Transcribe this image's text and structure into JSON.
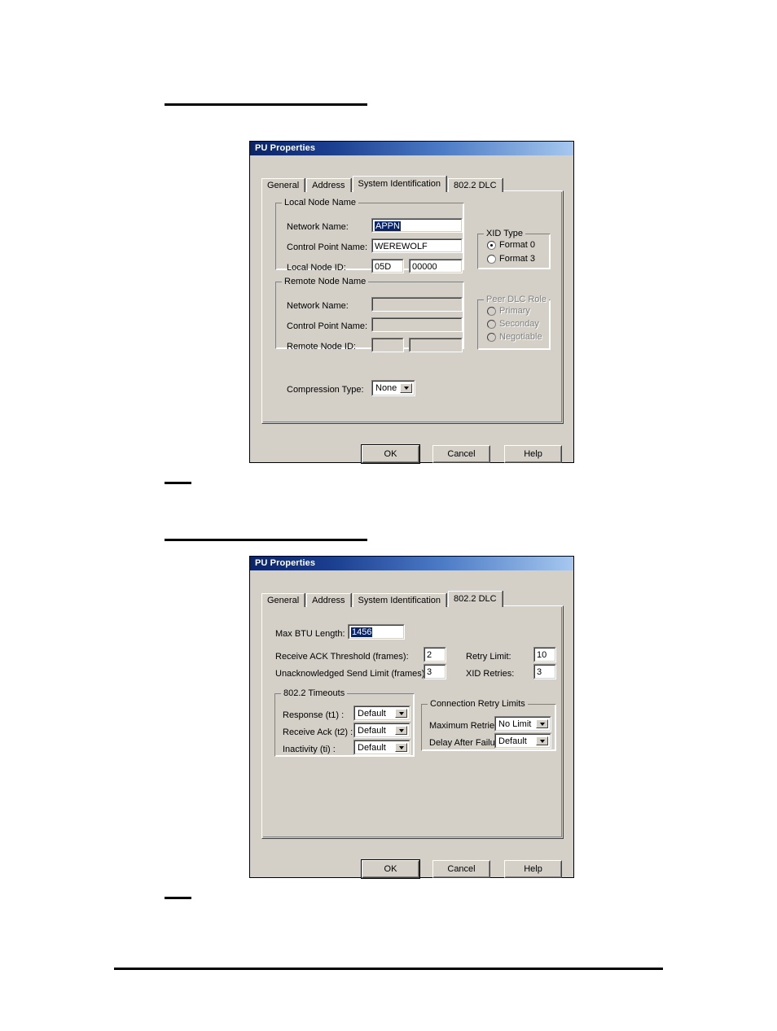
{
  "page": {
    "rules": [
      "rule-top",
      "rule-mid-a",
      "rule-mid-b",
      "rule-mid-c",
      "rule-bottom"
    ]
  },
  "dialog_sysid": {
    "title": "PU Properties",
    "tabs": [
      {
        "label": "General",
        "active": false
      },
      {
        "label": "Address",
        "active": false
      },
      {
        "label": "System Identification",
        "active": true
      },
      {
        "label": "802.2 DLC",
        "active": false
      }
    ],
    "local_node_name": {
      "group_label": "Local Node Name",
      "network_name_label": "Network Name:",
      "network_name_value": "APPN",
      "control_point_name_label": "Control Point Name:",
      "control_point_name_value": "WEREWOLF",
      "local_node_id_label": "Local Node ID:",
      "local_node_id_block": "05D",
      "local_node_id_number": "00000"
    },
    "xid_type": {
      "group_label": "XID Type",
      "options": [
        {
          "label": "Format 0",
          "checked": true
        },
        {
          "label": "Format 3",
          "checked": false
        }
      ]
    },
    "remote_node_name": {
      "group_label": "Remote Node Name",
      "network_name_label": "Network Name:",
      "network_name_value": "",
      "control_point_name_label": "Control Point Name:",
      "control_point_name_value": "",
      "remote_node_id_label": "Remote Node ID:",
      "remote_node_id_block": "",
      "remote_node_id_number": ""
    },
    "peer_dlc_role": {
      "group_label": "Peer DLC Role",
      "options": [
        {
          "label": "Primary",
          "checked": false
        },
        {
          "label": "Seconday",
          "checked": false
        },
        {
          "label": "Negotiable",
          "checked": false
        }
      ]
    },
    "compression": {
      "label": "Compression Type:",
      "value": "None"
    },
    "buttons": {
      "ok": "OK",
      "cancel": "Cancel",
      "help": "Help"
    }
  },
  "dialog_dlc": {
    "title": "PU Properties",
    "tabs": [
      {
        "label": "General",
        "active": false
      },
      {
        "label": "Address",
        "active": false
      },
      {
        "label": "System Identification",
        "active": false
      },
      {
        "label": "802.2 DLC",
        "active": true
      }
    ],
    "fields": {
      "max_btu_label": "Max BTU Length:",
      "max_btu_value": "1456",
      "recv_ack_threshold_label": "Receive ACK Threshold (frames):",
      "recv_ack_threshold_value": "2",
      "unack_send_limit_label": "Unacknowledged Send Limit (frames):",
      "unack_send_limit_value": "3",
      "retry_limit_label": "Retry Limit:",
      "retry_limit_value": "10",
      "xid_retries_label": "XID Retries:",
      "xid_retries_value": "3"
    },
    "timeouts": {
      "group_label": "802.2 Timeouts",
      "response_label": "Response (t1) :",
      "response_value": "Default",
      "receive_ack_label": "Receive Ack (t2) :",
      "receive_ack_value": "Default",
      "inactivity_label": "Inactivity (ti) :",
      "inactivity_value": "Default"
    },
    "retry_limits": {
      "group_label": "Connection Retry Limits",
      "max_retries_label": "Maximum Retries:",
      "max_retries_value": "No Limit",
      "delay_after_failure_label": "Delay After Failure:",
      "delay_after_failure_value": "Default"
    },
    "buttons": {
      "ok": "OK",
      "cancel": "Cancel",
      "help": "Help"
    }
  }
}
